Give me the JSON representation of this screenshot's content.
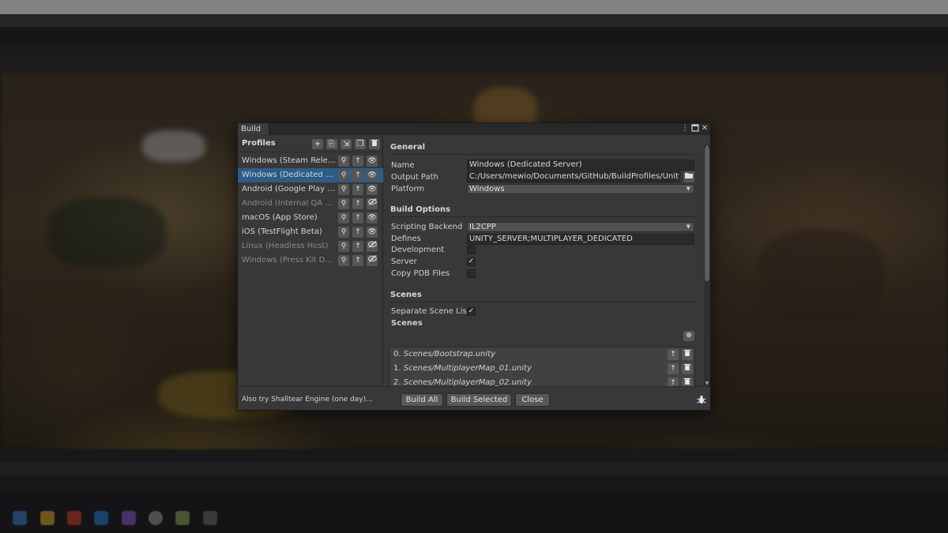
{
  "window": {
    "tab_title": "Build",
    "menu_icon": "kebab-menu-icon",
    "maximize_icon": "maximize-icon",
    "close_icon": "close-icon"
  },
  "profiles": {
    "title": "Profiles",
    "header_buttons": [
      "add-profile-icon",
      "import-profile-icon",
      "export-profile-icon",
      "duplicate-profile-icon",
      "delete-profile-icon"
    ],
    "items": [
      {
        "label": "Windows (Steam Release)",
        "selected": false,
        "enabled": true,
        "visibility": "eye-icon"
      },
      {
        "label": "Windows (Dedicated Server)",
        "selected": true,
        "enabled": true,
        "visibility": "eye-icon"
      },
      {
        "label": "Android (Google Play Production)",
        "selected": false,
        "enabled": true,
        "visibility": "eye-icon"
      },
      {
        "label": "Android (Internal QA APK)",
        "selected": false,
        "enabled": false,
        "visibility": "eye-off-icon"
      },
      {
        "label": "macOS (App Store)",
        "selected": false,
        "enabled": true,
        "visibility": "eye-icon"
      },
      {
        "label": "iOS (TestFlight Beta)",
        "selected": false,
        "enabled": true,
        "visibility": "eye-icon"
      },
      {
        "label": "Linux (Headless Host)",
        "selected": false,
        "enabled": false,
        "visibility": "eye-off-icon"
      },
      {
        "label": "Windows (Press Kit Demo)",
        "selected": false,
        "enabled": false,
        "visibility": "eye-off-icon"
      }
    ]
  },
  "general": {
    "title": "General",
    "name_label": "Name",
    "name_value": "Windows (Dedicated Server)",
    "output_label": "Output Path",
    "output_value": "C:/Users/mewio/Documents/GitHub/BuildProfiles/UnityProje",
    "platform_label": "Platform",
    "platform_value": "Windows"
  },
  "build_options": {
    "title": "Build Options",
    "backend_label": "Scripting Backend",
    "backend_value": "IL2CPP",
    "defines_label": "Defines",
    "defines_value": "UNITY_SERVER;MULTIPLAYER_DEDICATED",
    "development_label": "Development",
    "development_checked": false,
    "server_label": "Server",
    "server_checked": true,
    "copy_pdb_label": "Copy PDB Files",
    "copy_pdb_checked": false
  },
  "scenes": {
    "title": "Scenes",
    "separate_label": "Separate Scene List",
    "separate_checked": true,
    "list_label": "Scenes",
    "items": [
      {
        "index": "0.",
        "path": "Scenes/Bootstrap.unity"
      },
      {
        "index": "1.",
        "path": "Scenes/MultiplayerMap_01.unity"
      },
      {
        "index": "2.",
        "path": "Scenes/MultiplayerMap_02.unity"
      }
    ]
  },
  "footer": {
    "note": "Also try Shalltear Engine (one day)...",
    "build_all": "Build All",
    "build_selected": "Build Selected",
    "close": "Close"
  },
  "colors": {
    "selection": "#2c5d87",
    "panel": "#383838",
    "field": "#2a2a2a"
  }
}
